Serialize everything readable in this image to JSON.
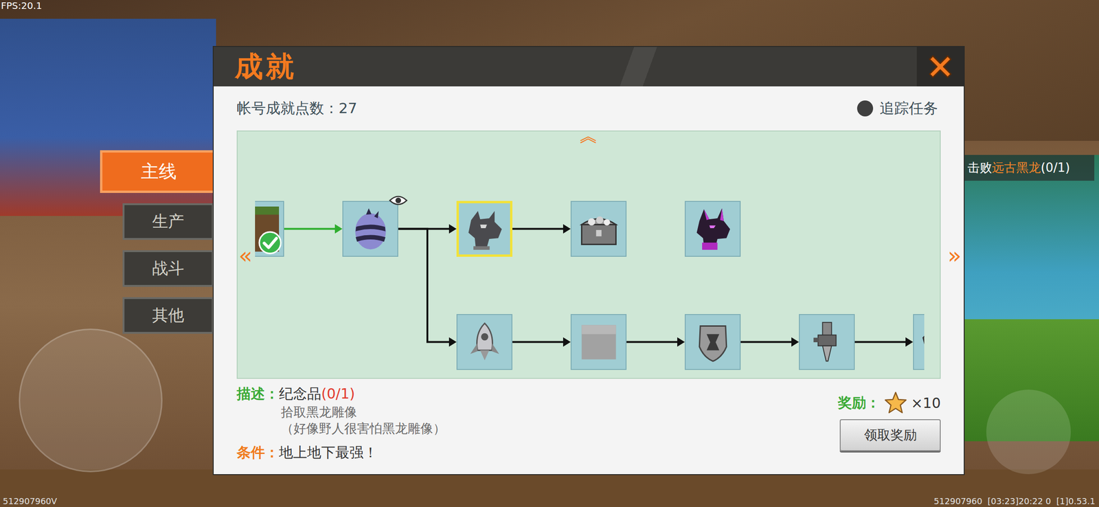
{
  "fps": "FPS:20.1",
  "dialog": {
    "title": "成就",
    "points_label": "帐号成就点数：",
    "points": "27",
    "track": {
      "label": "追踪任务",
      "on": false
    }
  },
  "tabs": [
    {
      "label": "主线",
      "selected": true
    },
    {
      "label": "生产",
      "selected": false
    },
    {
      "label": "战斗",
      "selected": false
    },
    {
      "label": "其他",
      "selected": false
    }
  ],
  "tree": {
    "scroll_up": "︽",
    "scroll_left": "«",
    "scroll_right": "»",
    "main": [
      {
        "kind": "dirt",
        "completed": true,
        "selected": false,
        "viewed": false,
        "arrow_in": "none"
      },
      {
        "kind": "egg",
        "completed": false,
        "selected": false,
        "viewed": true,
        "arrow_in": "done"
      },
      {
        "kind": "dragon-statue",
        "completed": false,
        "selected": true,
        "viewed": false,
        "arrow_in": "open"
      },
      {
        "kind": "chest",
        "completed": false,
        "selected": false,
        "viewed": false,
        "arrow_in": "open"
      },
      {
        "kind": "purple-dragon",
        "completed": false,
        "selected": false,
        "viewed": false,
        "arrow_in": "none"
      }
    ],
    "branch": [
      {
        "kind": "rocket",
        "completed": false,
        "selected": false,
        "viewed": false,
        "arrow_in": "open"
      },
      {
        "kind": "stone",
        "completed": false,
        "selected": false,
        "viewed": false,
        "arrow_in": "open"
      },
      {
        "kind": "shield",
        "completed": false,
        "selected": false,
        "viewed": false,
        "arrow_in": "open"
      },
      {
        "kind": "drill",
        "completed": false,
        "selected": false,
        "viewed": false,
        "arrow_in": "open"
      },
      {
        "kind": "partial",
        "completed": false,
        "selected": false,
        "viewed": false,
        "arrow_in": "open"
      }
    ]
  },
  "detail": {
    "description_label": "描述：",
    "name": "纪念品",
    "progress": "(0/1)",
    "lines": [
      "拾取黑龙雕像",
      "（好像野人很害怕黑龙雕像）"
    ],
    "condition_label": "条件：",
    "condition": "地上地下最强！",
    "reward_label": "奖励：",
    "reward_count": "×10",
    "claim_button": "领取奖励"
  },
  "tracker": {
    "prefix": "击败",
    "target": "远古黑龙",
    "progress": "(0/1)"
  },
  "status": {
    "left": "512907960V",
    "right": "512907960  [03:23]20:22 0  [1]0.53.1"
  }
}
